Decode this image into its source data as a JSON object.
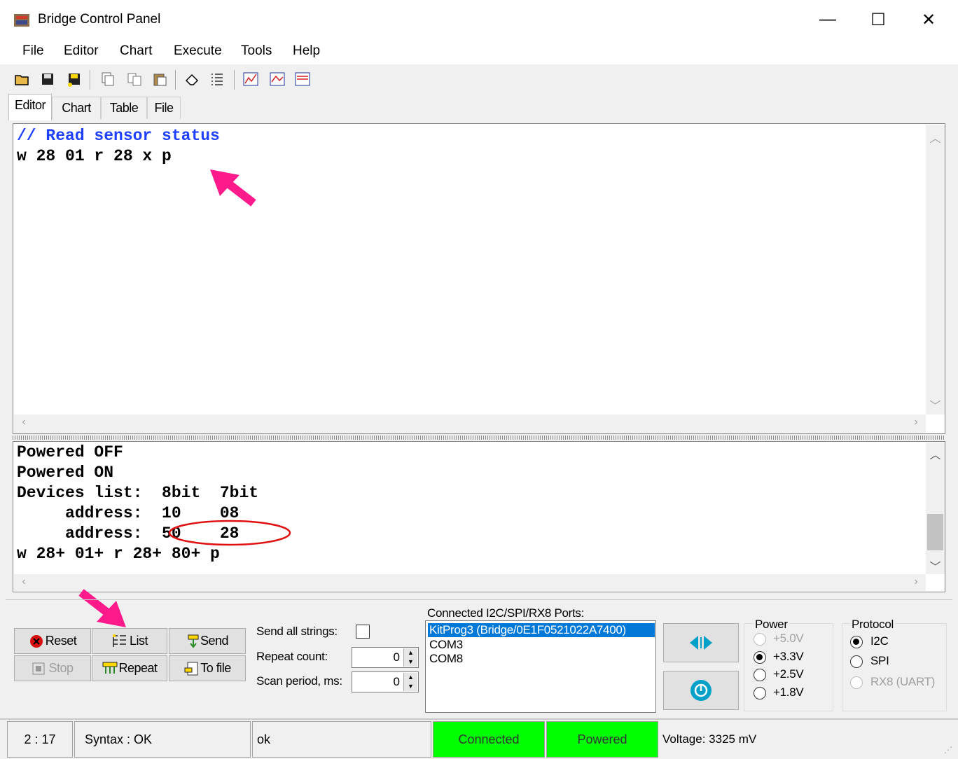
{
  "window": {
    "title": "Bridge Control Panel",
    "minimize": "—",
    "maximize": "☐",
    "close": "✕"
  },
  "menu": [
    "File",
    "Editor",
    "Chart",
    "Execute",
    "Tools",
    "Help"
  ],
  "tabs": [
    "Editor",
    "Chart",
    "Table",
    "File"
  ],
  "editor": {
    "lines": [
      {
        "text": "// Read sensor status",
        "color": "#1f3fff"
      },
      {
        "text": "w 28 01 r 28 x p",
        "color": "#000000"
      }
    ]
  },
  "output": {
    "lines": [
      "Powered OFF",
      "Powered ON",
      "Devices list:  8bit  7bit",
      "     address:  10    08",
      "     address:  50    28",
      "w 28+ 01+ r 28+ 80+ p"
    ]
  },
  "buttons": {
    "reset": "Reset",
    "list": "List",
    "send": "Send",
    "stop": "Stop",
    "repeat": "Repeat",
    "to_file": "To file"
  },
  "options": {
    "send_all_strings_label": "Send all strings:",
    "repeat_count_label": "Repeat count:",
    "repeat_count_value": "0",
    "scan_period_label": "Scan period, ms:",
    "scan_period_value": "0"
  },
  "ports": {
    "label": "Connected I2C/SPI/RX8 Ports:",
    "items": [
      "KitProg3 (Bridge/0E1F0521022A7400)",
      "COM3",
      "COM8"
    ],
    "selected_index": 0
  },
  "power": {
    "label": "Power",
    "options": [
      "+5.0V",
      "+3.3V",
      "+2.5V",
      "+1.8V"
    ],
    "selected": "+3.3V"
  },
  "protocol": {
    "label": "Protocol",
    "options": [
      "I2C",
      "SPI",
      "RX8 (UART)"
    ],
    "selected": "I2C"
  },
  "status": {
    "position": "2 : 17",
    "syntax": "Syntax : OK",
    "message": "ok",
    "connected": "Connected",
    "powered": "Powered",
    "voltage": "Voltage: 3325 mV"
  },
  "colors": {
    "accent_arrow": "#ff1a8c",
    "highlight_circle": "#e01010",
    "status_green": "#00ff00",
    "selection_blue": "#0078d7",
    "icon_teal": "#00a0c8"
  }
}
